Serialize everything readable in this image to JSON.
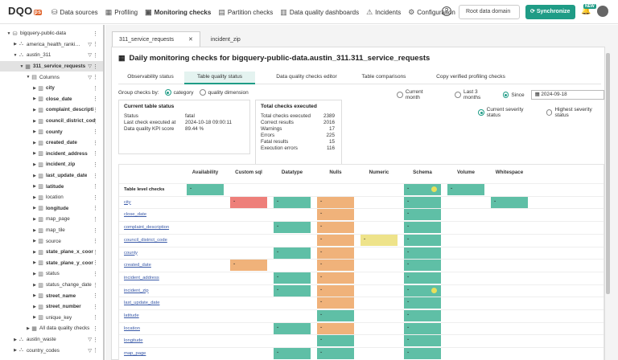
{
  "app": {
    "logo": "DQO",
    "logo_suffix": "ps"
  },
  "nav": [
    {
      "label": "Data sources",
      "icon": "⛁"
    },
    {
      "label": "Profiling",
      "icon": "▦"
    },
    {
      "label": "Monitoring checks",
      "icon": "▣"
    },
    {
      "label": "Partition checks",
      "icon": "▤"
    },
    {
      "label": "Data quality dashboards",
      "icon": "▥"
    },
    {
      "label": "Incidents",
      "icon": "⚠"
    },
    {
      "label": "Configuration",
      "icon": "⚙"
    }
  ],
  "header": {
    "help": "?",
    "domain": "Root data domain",
    "sync": "Synchronize",
    "new_badge": "NEW"
  },
  "tree": [
    {
      "label": "bigquery-public-data",
      "arrow": "▼",
      "icon": "⛁",
      "indent": 8,
      "bold": false
    },
    {
      "label": "america_health_rankings",
      "arrow": "▶",
      "icon": "⛬",
      "indent": 16,
      "bold": false,
      "filter": true
    },
    {
      "label": "austin_311",
      "arrow": "▼",
      "icon": "⛬",
      "indent": 16,
      "bold": false,
      "filter": true
    },
    {
      "label": "311_service_requests",
      "arrow": "▼",
      "icon": "▦",
      "indent": 24,
      "bold": true,
      "filter": true,
      "selected": true
    },
    {
      "label": "Columns",
      "arrow": "▼",
      "icon": "▤",
      "indent": 32,
      "bold": false,
      "filter": true
    },
    {
      "label": "city",
      "arrow": "▶",
      "icon": "▥",
      "indent": 40,
      "bold": true
    },
    {
      "label": "close_date",
      "arrow": "▶",
      "icon": "▥",
      "indent": 40,
      "bold": true
    },
    {
      "label": "complaint_descripti",
      "arrow": "▶",
      "icon": "▥",
      "indent": 40,
      "bold": true
    },
    {
      "label": "council_district_cod",
      "arrow": "▶",
      "icon": "▥",
      "indent": 40,
      "bold": true
    },
    {
      "label": "county",
      "arrow": "▶",
      "icon": "▥",
      "indent": 40,
      "bold": true
    },
    {
      "label": "created_date",
      "arrow": "▶",
      "icon": "▥",
      "indent": 40,
      "bold": true
    },
    {
      "label": "incident_address",
      "arrow": "▶",
      "icon": "▥",
      "indent": 40,
      "bold": true
    },
    {
      "label": "incident_zip",
      "arrow": "▶",
      "icon": "▥",
      "indent": 40,
      "bold": true
    },
    {
      "label": "last_update_date",
      "arrow": "▶",
      "icon": "▥",
      "indent": 40,
      "bold": true
    },
    {
      "label": "latitude",
      "arrow": "▶",
      "icon": "▥",
      "indent": 40,
      "bold": true
    },
    {
      "label": "location",
      "arrow": "▶",
      "icon": "▥",
      "indent": 40,
      "bold": false
    },
    {
      "label": "longitude",
      "arrow": "▶",
      "icon": "▥",
      "indent": 40,
      "bold": true
    },
    {
      "label": "map_page",
      "arrow": "▶",
      "icon": "▥",
      "indent": 40,
      "bold": false
    },
    {
      "label": "map_tile",
      "arrow": "▶",
      "icon": "▥",
      "indent": 40,
      "bold": false
    },
    {
      "label": "source",
      "arrow": "▶",
      "icon": "▥",
      "indent": 40,
      "bold": false
    },
    {
      "label": "state_plane_x_coor",
      "arrow": "▶",
      "icon": "▥",
      "indent": 40,
      "bold": true
    },
    {
      "label": "state_plane_y_coor",
      "arrow": "▶",
      "icon": "▥",
      "indent": 40,
      "bold": true
    },
    {
      "label": "status",
      "arrow": "▶",
      "icon": "▥",
      "indent": 40,
      "bold": false
    },
    {
      "label": "status_change_date",
      "arrow": "▶",
      "icon": "▥",
      "indent": 40,
      "bold": false
    },
    {
      "label": "street_name",
      "arrow": "▶",
      "icon": "▥",
      "indent": 40,
      "bold": true
    },
    {
      "label": "street_number",
      "arrow": "▶",
      "icon": "▥",
      "indent": 40,
      "bold": true
    },
    {
      "label": "unique_key",
      "arrow": "▶",
      "icon": "▥",
      "indent": 40,
      "bold": false
    },
    {
      "label": "All data quality checks",
      "arrow": "▶",
      "icon": "▦",
      "indent": 32,
      "bold": false
    },
    {
      "label": "austin_waste",
      "arrow": "▶",
      "icon": "⛬",
      "indent": 16,
      "bold": false,
      "filter": true
    },
    {
      "label": "country_codes",
      "arrow": "▶",
      "icon": "⛬",
      "indent": 16,
      "bold": false,
      "filter": true
    }
  ],
  "tabs": [
    {
      "label": "311_service_requests",
      "close": "✕",
      "active": true
    },
    {
      "label": "incident_zip",
      "close": "",
      "active": false
    }
  ],
  "panel": {
    "title": "Daily monitoring checks for bigquery-public-data.austin_311.311_service_requests",
    "subtabs": [
      "Observability status",
      "Table quality status",
      "Data quality checks editor",
      "Table comparisons",
      "Copy verified profiling checks"
    ],
    "active_subtab": 1,
    "group_by_label": "Group checks by:",
    "group_by_options": [
      "category",
      "quality dimension"
    ],
    "period_options": [
      "Current month",
      "Last 3 months",
      "Since"
    ],
    "since_date": "2024-09-18",
    "severity_options": [
      "Current severity status",
      "Highest severity status"
    ]
  },
  "current_status": {
    "title": "Current table status",
    "rows": [
      {
        "k": "Status",
        "v": "fatal"
      },
      {
        "k": "Last check executed at",
        "v": "2024-10-18 09:00:11"
      },
      {
        "k": "Data quality KPI score",
        "v": "89.44 %"
      }
    ]
  },
  "totals": {
    "title": "Total checks executed",
    "rows": [
      {
        "k": "Total checks executed",
        "v": "2389"
      },
      {
        "k": "Correct results",
        "v": "2016"
      },
      {
        "k": "Warnings",
        "v": "17"
      },
      {
        "k": "Errors",
        "v": "225"
      },
      {
        "k": "Fatal results",
        "v": "15"
      },
      {
        "k": "Execution errors",
        "v": "116"
      }
    ]
  },
  "colors": {
    "valid": "#5fbfa6",
    "error": "#f0b27a",
    "fatal": "#ee7f7a",
    "warning": "#eee38a",
    "accent": "#1f9c86"
  },
  "grid": {
    "columns": [
      "Availability",
      "Custom sql",
      "Datatype",
      "Nulls",
      "Numeric",
      "Schema",
      "Volume",
      "Whitespace"
    ],
    "rows": [
      {
        "label": "Table level checks",
        "head": true,
        "cells": [
          "valid",
          "",
          "",
          "",
          "",
          "valid-dot",
          "valid",
          ""
        ]
      },
      {
        "label": "city",
        "cells": [
          "",
          "fatal",
          "valid",
          "error",
          "",
          "valid",
          "",
          "valid"
        ]
      },
      {
        "label": "close_date",
        "cells": [
          "",
          "",
          "",
          "error",
          "",
          "valid",
          "",
          ""
        ]
      },
      {
        "label": "complaint_description",
        "cells": [
          "",
          "",
          "valid",
          "error",
          "",
          "valid",
          "",
          ""
        ]
      },
      {
        "label": "council_district_code",
        "cells": [
          "",
          "",
          "",
          "error",
          "warning",
          "valid",
          "",
          ""
        ]
      },
      {
        "label": "county",
        "cells": [
          "",
          "",
          "valid",
          "error",
          "",
          "valid",
          "",
          ""
        ]
      },
      {
        "label": "created_date",
        "cells": [
          "",
          "error",
          "",
          "error",
          "",
          "valid",
          "",
          ""
        ]
      },
      {
        "label": "incident_address",
        "cells": [
          "",
          "",
          "valid",
          "error",
          "",
          "valid",
          "",
          ""
        ]
      },
      {
        "label": "incident_zip",
        "cells": [
          "",
          "",
          "valid",
          "error",
          "",
          "valid-dot",
          "",
          ""
        ]
      },
      {
        "label": "last_update_date",
        "cells": [
          "",
          "",
          "",
          "error",
          "",
          "valid",
          "",
          ""
        ]
      },
      {
        "label": "latitude",
        "cells": [
          "",
          "",
          "",
          "valid",
          "",
          "valid",
          "",
          ""
        ]
      },
      {
        "label": "location",
        "cells": [
          "",
          "",
          "valid",
          "error",
          "",
          "valid",
          "",
          ""
        ]
      },
      {
        "label": "longitude",
        "cells": [
          "",
          "",
          "",
          "valid",
          "",
          "valid",
          "",
          ""
        ]
      },
      {
        "label": "map_page",
        "cells": [
          "",
          "",
          "valid",
          "valid",
          "",
          "valid",
          "",
          ""
        ]
      }
    ]
  }
}
